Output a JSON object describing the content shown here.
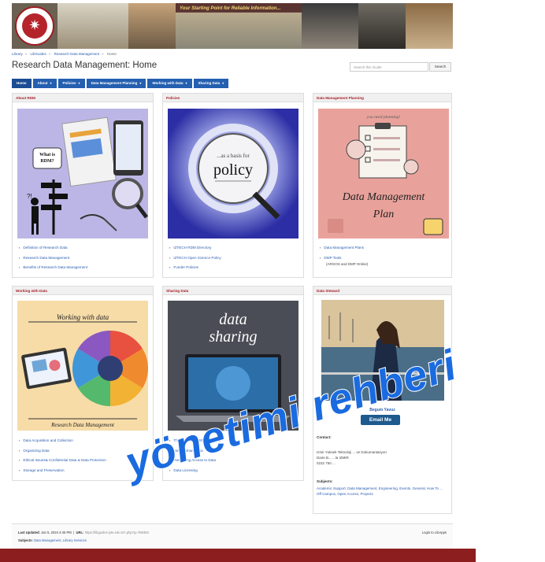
{
  "banner": {
    "tagline": "Your Starting Point for Reliable Information...",
    "logo_icon": "university-seal-icon"
  },
  "breadcrumb": [
    "Library",
    "LibGuides",
    "Research Data Management",
    "Home"
  ],
  "page": {
    "title": "Research Data Management: Home"
  },
  "search": {
    "placeholder": "Search this Guide",
    "button": "Search"
  },
  "nav": {
    "tabs": [
      {
        "label": "Home",
        "dropdown": false
      },
      {
        "label": "About",
        "dropdown": true
      },
      {
        "label": "Policies",
        "dropdown": true
      },
      {
        "label": "Data Management Planning",
        "dropdown": true
      },
      {
        "label": "Working with Data",
        "dropdown": true
      },
      {
        "label": "Sharing Data",
        "dropdown": true
      }
    ]
  },
  "panels": {
    "about": {
      "title": "About RDM",
      "image_text": "What is RDM?",
      "links": [
        "Definition of Research Data",
        "Research Data Management",
        "Benefits of Research Data Management"
      ]
    },
    "policies": {
      "title": "Policies",
      "image_text": "policy",
      "links": [
        "IZTECH RDM Directory",
        "IZTECH Open Science Policy",
        "Funder Policies"
      ]
    },
    "dmp": {
      "title": "Data Management Planning",
      "image_top": "you need planning!",
      "image_text": "Data Management Plan",
      "links": [
        "Data Management Plans",
        "DMP Tools"
      ],
      "dmp_sub": "(ARGOS and DMP Online)"
    },
    "working": {
      "title": "Working with Data",
      "image_top": "Working with data",
      "image_bottom": "Research Data Management",
      "links": [
        "Data Acquisition and Collection",
        "Organizing Data",
        "Ethical Issues& Confidential Data & Data Protection",
        "Storage and Preservation"
      ]
    },
    "sharing": {
      "title": "Sharing Data",
      "image_text": "data sharing",
      "links": [
        "The Benefits of Sharing Data",
        "How to share data",
        "Restricting Access to Data",
        "Data Licensing"
      ]
    },
    "steward": {
      "title": "Data Steward",
      "name": "Begum Yavuz",
      "email_button": "Email Me",
      "contact_label": "Contact:",
      "contact_line1": "Izmir Yuksek Teknoloji ... ve Dokumantasyon",
      "contact_line2": "Daire B... ...la IZMIR",
      "contact_line3": "0232 750 ...",
      "subjects_label": "Subjects:",
      "subjects": "Academic Support, Data Management, Engineering, Events, General, How To ... Off Campus, Open Access, Projects"
    }
  },
  "footer": {
    "last_updated_label": "Last Updated:",
    "last_updated": "Jan 5, 2024 4:45 PM",
    "url_label": "URL:",
    "url": "https://libguides.iyte.edu.tr/c.php?g=788493",
    "login": "Login to LibApps",
    "subjects_label": "Subjects:",
    "subjects": "Data Management, Library Services"
  },
  "watermark": "yönetimi rehberi",
  "colors": {
    "accent_red": "#a8212a",
    "nav_blue": "#245fb0",
    "link_blue": "#2a5db0",
    "footer_bar": "#8d1e1f",
    "watermark_blue": "#1a6be0"
  }
}
